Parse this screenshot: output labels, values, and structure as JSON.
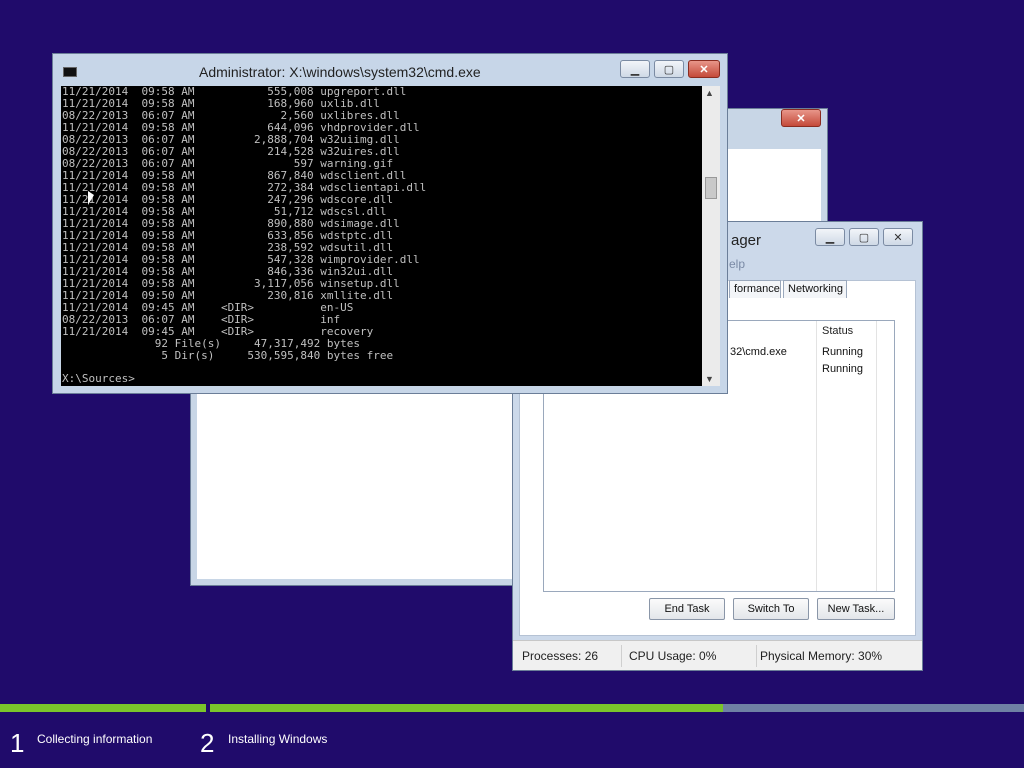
{
  "cmd": {
    "title": "Administrator: X:\\windows\\system32\\cmd.exe",
    "lines": [
      "11/21/2014  09:58 AM           555,008 upgreport.dll",
      "11/21/2014  09:58 AM           168,960 uxlib.dll",
      "08/22/2013  06:07 AM             2,560 uxlibres.dll",
      "11/21/2014  09:58 AM           644,096 vhdprovider.dll",
      "08/22/2013  06:07 AM         2,888,704 w32uiimg.dll",
      "08/22/2013  06:07 AM           214,528 w32uires.dll",
      "08/22/2013  06:07 AM               597 warning.gif",
      "11/21/2014  09:58 AM           867,840 wdsclient.dll",
      "11/21/2014  09:58 AM           272,384 wdsclientapi.dll",
      "11/21/2014  09:58 AM           247,296 wdscore.dll",
      "11/21/2014  09:58 AM            51,712 wdscsl.dll",
      "11/21/2014  09:58 AM           890,880 wdsimage.dll",
      "11/21/2014  09:58 AM           633,856 wdstptc.dll",
      "11/21/2014  09:58 AM           238,592 wdsutil.dll",
      "11/21/2014  09:58 AM           547,328 wimprovider.dll",
      "11/21/2014  09:58 AM           846,336 win32ui.dll",
      "11/21/2014  09:58 AM         3,117,056 winsetup.dll",
      "11/21/2014  09:50 AM           230,816 xmllite.dll",
      "11/21/2014  09:45 AM    <DIR>          en-US",
      "08/22/2013  06:07 AM    <DIR>          inf",
      "11/21/2014  09:45 AM    <DIR>          recovery",
      "              92 File(s)     47,317,492 bytes",
      "               5 Dir(s)     530,595,840 bytes free"
    ],
    "prompt": "X:\\Sources>"
  },
  "taskmgr": {
    "title_partial": "ager",
    "menu_partial": "elp",
    "tabs": [
      "formance",
      "Networking"
    ],
    "column_status": "Status",
    "rows": [
      {
        "task": "32\\cmd.exe",
        "status": "Running"
      },
      {
        "task": "",
        "status": "Running"
      }
    ],
    "buttons": {
      "end_task": "End Task",
      "switch_to": "Switch To",
      "new_task": "New Task..."
    },
    "statusbar": {
      "processes": "Processes: 26",
      "cpu": "CPU Usage: 0%",
      "memory": "Physical Memory: 30%"
    }
  },
  "setup": {
    "steps": [
      {
        "num": "1",
        "label": "Collecting information"
      },
      {
        "num": "2",
        "label": "Installing Windows"
      }
    ],
    "step2_progress": 0.63
  },
  "colors": {
    "desktop": "#200b6b",
    "progress_green": "#7bc52b",
    "progress_track": "#6f81a4"
  }
}
